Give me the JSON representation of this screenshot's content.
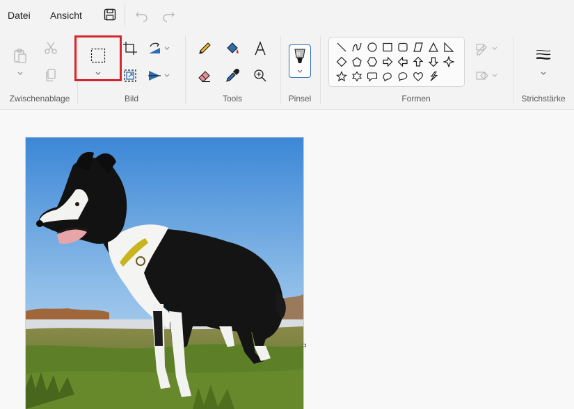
{
  "menu": {
    "datei": "Datei",
    "ansicht": "Ansicht"
  },
  "ribbon": {
    "groups": {
      "zwischenablage": "Zwischenablage",
      "bild": "Bild",
      "tools": "Tools",
      "pinsel": "Pinsel",
      "formen": "Formen",
      "strichstaerke": "Strichstärke"
    }
  },
  "icons": {
    "save": "save-icon",
    "undo": "undo-icon",
    "redo": "redo-icon",
    "paste": "paste-icon",
    "cut": "scissors-icon",
    "copy": "copy-icon",
    "select": "rectangle-select-icon",
    "crop": "crop-icon",
    "resize": "resize-icon",
    "rotate": "rotate-icon",
    "flip": "flip-icon",
    "pencil": "pencil-icon",
    "fill": "fill-bucket-icon",
    "text": "text-icon",
    "eraser": "eraser-icon",
    "color_picker": "color-picker-icon",
    "magnifier": "magnifier-icon",
    "brush": "brush-icon",
    "outline": "outline-icon",
    "shape_fill": "shape-fill-icon",
    "stroke_size": "stroke-size-icon"
  },
  "colors": {
    "highlight": "#d4262d",
    "accent": "#2e6db3",
    "ribbon_bg": "#f3f3f3",
    "canvas_bg": "#f8f8f8"
  },
  "image": {
    "subject": "border collie standing in grass under blue sky"
  }
}
